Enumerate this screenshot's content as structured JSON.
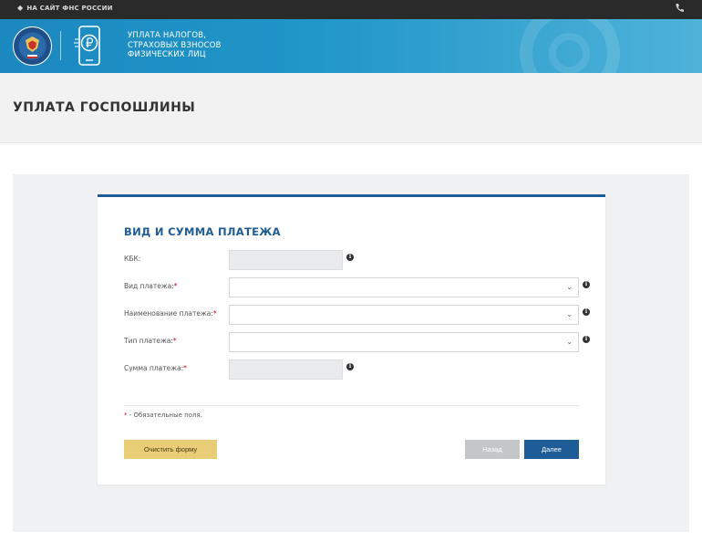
{
  "topbar": {
    "back_label": "НА САЙТ ФНС РОССИИ",
    "icons": [
      "arrow-left-icon",
      "phone-icon"
    ]
  },
  "header": {
    "title_lines": [
      "УПЛАТА НАЛОГОВ,",
      "СТРАХОВЫХ ВЗНОСОВ",
      "ФИЗИЧЕСКИХ ЛИЦ"
    ],
    "icons": [
      "fns-emblem-icon",
      "phone-ruble-icon"
    ]
  },
  "page": {
    "title": "УПЛАТА ГОСПОШЛИНЫ"
  },
  "form": {
    "heading": "ВИД И СУММА ПЛАТЕЖА",
    "fields": [
      {
        "label": "КБК:",
        "required": false,
        "type": "readonly",
        "value": ""
      },
      {
        "label": "Вид платежа:",
        "required": true,
        "type": "select",
        "value": ""
      },
      {
        "label": "Наименование платежа:",
        "required": true,
        "type": "select",
        "value": ""
      },
      {
        "label": "Тип платежа:",
        "required": true,
        "type": "select",
        "value": ""
      },
      {
        "label": "Сумма платежа:",
        "required": true,
        "type": "readonly",
        "value": ""
      }
    ],
    "required_mark": "*",
    "required_note": " - Обязательные поля.",
    "buttons": {
      "clear": "Очистить форму",
      "back": "Назад",
      "next": "Далее"
    }
  },
  "colors": {
    "accent": "#1d5c96",
    "header_blue": "#2196c9",
    "clear_button": "#e8cc76",
    "disabled_button": "#c4c6c8",
    "required": "#d0021b"
  }
}
